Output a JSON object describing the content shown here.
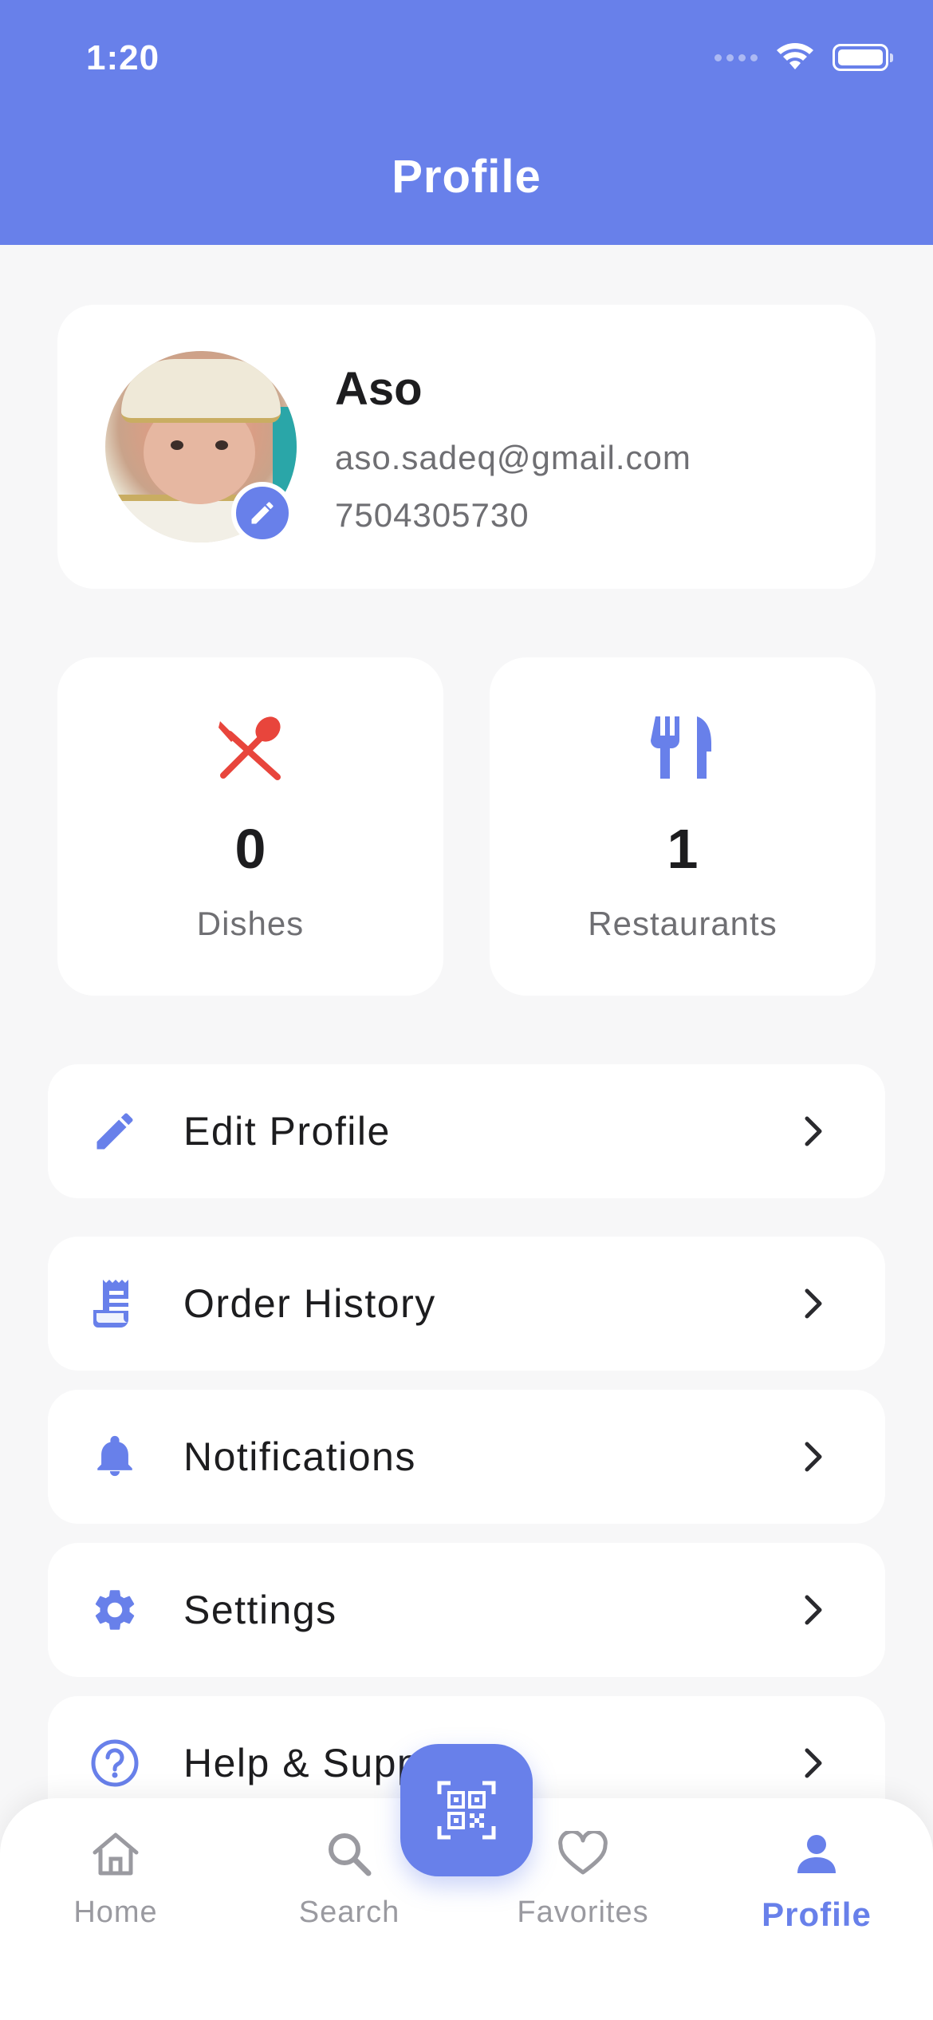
{
  "status_bar": {
    "time": "1:20"
  },
  "header": {
    "title": "Profile"
  },
  "profile": {
    "name": "Aso",
    "email": "aso.sadeq@gmail.com",
    "phone": "7504305730"
  },
  "stats": [
    {
      "value": "0",
      "label": "Dishes",
      "icon": "dishes-icon",
      "color": "#e8453c"
    },
    {
      "value": "1",
      "label": "Restaurants",
      "icon": "restaurant-icon",
      "color": "#6880ea"
    }
  ],
  "menu": [
    {
      "label": "Edit Profile",
      "icon": "pencil-icon"
    },
    {
      "label": "Order History",
      "icon": "receipt-icon"
    },
    {
      "label": "Notifications",
      "icon": "bell-icon"
    },
    {
      "label": "Settings",
      "icon": "gear-icon"
    },
    {
      "label": "Help & Support",
      "icon": "help-icon"
    }
  ],
  "bottom_nav": [
    {
      "label": "Home",
      "icon": "home-icon",
      "active": false
    },
    {
      "label": "Search",
      "icon": "search-icon",
      "active": false
    },
    {
      "label": "Favorites",
      "icon": "heart-icon",
      "active": false
    },
    {
      "label": "Profile",
      "icon": "person-icon",
      "active": true
    }
  ],
  "qr_button": {
    "icon": "qr-scan-icon"
  },
  "colors": {
    "accent": "#6880ea",
    "danger": "#e8453c",
    "background": "#f7f7f8"
  }
}
